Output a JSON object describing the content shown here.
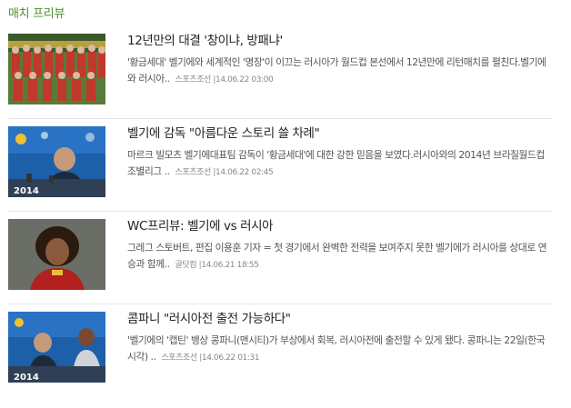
{
  "section": {
    "title": "매치 프리뷰"
  },
  "articles": [
    {
      "headline": "12년만의 대결 '창이냐, 방패냐'",
      "summary": "'황금세대' 벨기에와 세계적인 '명장'이 이끄는 러시아가 월드컵 본선에서 12년만에 리턴매치를 펼친다.벨기에와 러시아..",
      "source": "스포츠조선",
      "date": "|14.06.22 03:00",
      "thumb_icon": "team-photo-thumbnail"
    },
    {
      "headline": "벨기에 감독 \"아름다운 스토리 쓸 차례\"",
      "summary": "마르크 빌모츠 벨기에대표팀 감독이 '황금세대'에 대한 강한 믿음을 보였다.러시아와의 2014년 브라질월드컵 조별리그 ..",
      "source": "스포츠조선",
      "date": "|14.06.22 02:45",
      "thumb_icon": "press-conference-thumbnail",
      "thumb_text": "2014"
    },
    {
      "headline": "WC프리뷰: 벨기에 vs 러시아",
      "summary": "그레그 스토버트, 편집 이용훈 기자 = 첫 경기에서 완벽한 전력을 보여주지 못한 벨기에가 러시아를 상대로 연승과 함께..",
      "source": "골닷컴",
      "date": "|14.06.21 18:55",
      "thumb_icon": "player-portrait-thumbnail"
    },
    {
      "headline": "콤파니 \"러시아전 출전 가능하다\"",
      "summary": "'벨기에의 '캡틴' 뱅상 콩파니(맨시티)가 부상에서 회복, 러시아전에 출전할 수 있게 됐다. 콩파니는 22일(한국시각) ..",
      "source": "스포츠조선",
      "date": "|14.06.22 01:31",
      "thumb_icon": "press-conference-thumbnail",
      "thumb_text": "2014"
    }
  ]
}
